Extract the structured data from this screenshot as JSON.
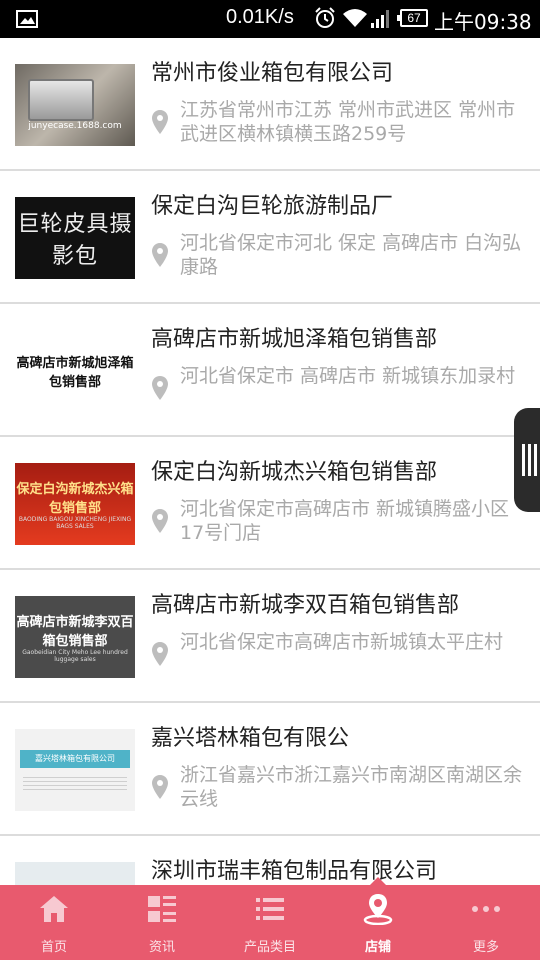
{
  "status_bar": {
    "net_speed": "0.01K/s",
    "battery": "67",
    "time": "上午09:38"
  },
  "stores": [
    {
      "name": "常州市俊业箱包有限公司",
      "address": "江苏省常州市江苏 常州市武进区 常州市武进区横林镇横玉路259号",
      "thumb_text": "junyecase.1688.com"
    },
    {
      "name": "保定白沟巨轮旅游制品厂",
      "address": "河北省保定市河北 保定 高碑店市 白沟弘康路",
      "thumb_text": "巨轮皮具摄影包"
    },
    {
      "name": "高碑店市新城旭泽箱包销售部",
      "address": "河北省保定市 高碑店市 新城镇东加录村",
      "thumb_text": "高碑店市新城旭泽箱包销售部"
    },
    {
      "name": "保定白沟新城杰兴箱包销售部",
      "address": "河北省保定市高碑店市 新城镇腾盛小区17号门店",
      "thumb_text": "保定白沟新城杰兴箱包销售部",
      "thumb_subtext": "BAODING BAIGOU XINCHENG JIEXING BAGS SALES"
    },
    {
      "name": "高碑店市新城李双百箱包销售部",
      "address": "河北省保定市高碑店市新城镇太平庄村",
      "thumb_text": "高碑店市新城李双百箱包销售部",
      "thumb_subtext": "Gaobeidian City Meho Lee hundred luggage sales"
    },
    {
      "name": "嘉兴塔林箱包有限公",
      "address": "浙江省嘉兴市浙江嘉兴市南湖区南湖区余云线",
      "thumb_text": "嘉兴塔林箱包有限公司"
    },
    {
      "name": "深圳市瑞丰箱包制品有限公司",
      "address": "",
      "thumb_text": ""
    }
  ],
  "tabs": [
    {
      "label": "首页",
      "icon": "home-icon",
      "active": false
    },
    {
      "label": "资讯",
      "icon": "news-grid-icon",
      "active": false
    },
    {
      "label": "产品类目",
      "icon": "category-list-icon",
      "active": false
    },
    {
      "label": "店铺",
      "icon": "store-pin-icon",
      "active": true
    },
    {
      "label": "更多",
      "icon": "more-dots-icon",
      "active": false
    }
  ],
  "colors": {
    "tabbar": "#e85a6e",
    "name_text": "#222222",
    "address_text": "#a9a9a9"
  }
}
